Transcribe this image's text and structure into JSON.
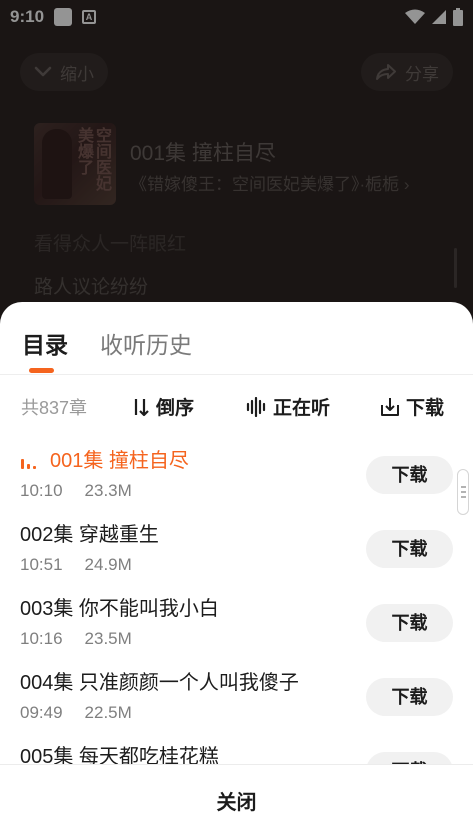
{
  "status_bar": {
    "time": "9:10",
    "icons": [
      "app-notification-icon",
      "a-icon",
      "wifi-icon",
      "signal-icon",
      "battery-icon"
    ]
  },
  "player": {
    "shrink_label": "缩小",
    "share_label": "分享",
    "episode_title": "001集 撞柱自尽",
    "book_line": "《错嫁傻王：空间医妃美爆了》·栀栀",
    "cover_text": "空间医妃美爆了",
    "lyrics": [
      "看得众人一阵眼红",
      "路人议论纷纷"
    ]
  },
  "sheet": {
    "tabs": [
      {
        "label": "目录",
        "active": true
      },
      {
        "label": "收听历史",
        "active": false
      }
    ],
    "total": "共837章",
    "sort_label": "倒序",
    "now_playing_label": "正在听",
    "download_all_label": "下载",
    "accent_color": "#f5641e",
    "episodes": [
      {
        "title": "001集 撞柱自尽",
        "duration": "10:10",
        "size": "23.3M",
        "button": "下载",
        "current": true
      },
      {
        "title": "002集 穿越重生",
        "duration": "10:51",
        "size": "24.9M",
        "button": "下载",
        "current": false
      },
      {
        "title": "003集 你不能叫我小白",
        "duration": "10:16",
        "size": "23.5M",
        "button": "下载",
        "current": false
      },
      {
        "title": "004集 只准颜颜一个人叫我傻子",
        "duration": "09:49",
        "size": "22.5M",
        "button": "下载",
        "current": false
      },
      {
        "title": "005集 每天都吃桂花糕",
        "duration": "",
        "size": "",
        "button": "下载",
        "current": false
      }
    ],
    "close_label": "关闭"
  }
}
